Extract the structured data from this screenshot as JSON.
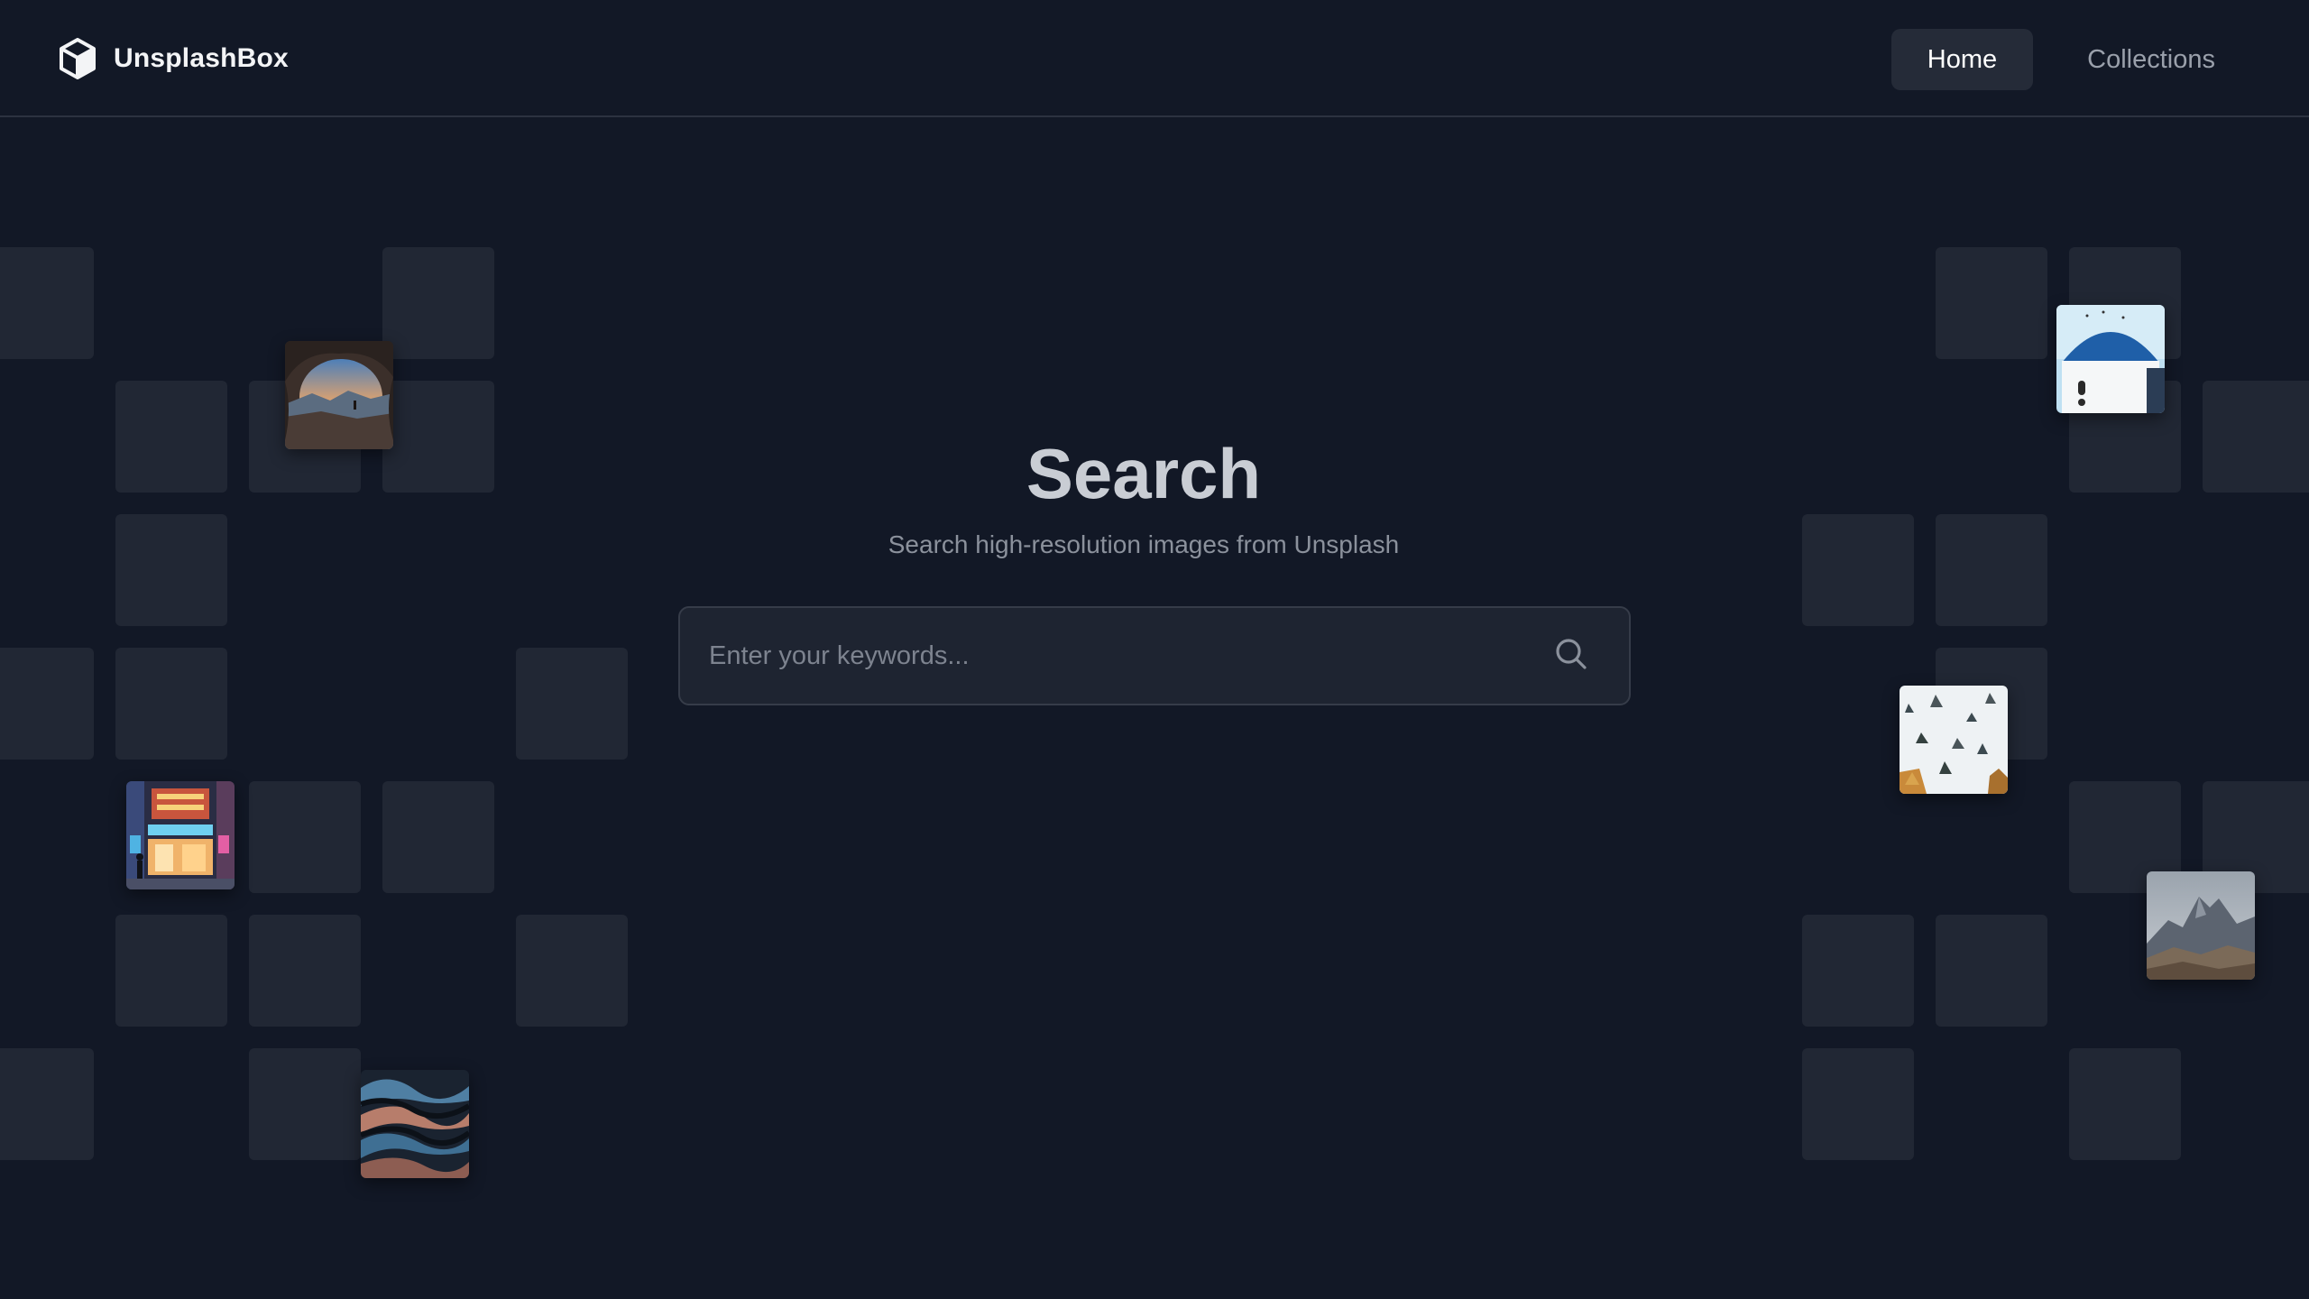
{
  "brand": {
    "name": "UnsplashBox",
    "icon": "cube-icon"
  },
  "nav": {
    "items": [
      {
        "label": "Home",
        "active": true
      },
      {
        "label": "Collections",
        "active": false
      }
    ]
  },
  "hero": {
    "title": "Search",
    "subtitle": "Search high-resolution images from Unsplash"
  },
  "search": {
    "placeholder": "Enter your keywords...",
    "value": "",
    "icon": "search-icon"
  },
  "colors": {
    "background": "#121826",
    "tile": "#212734",
    "nav_active_bg": "#252b38",
    "input_bg": "#1e2431"
  }
}
